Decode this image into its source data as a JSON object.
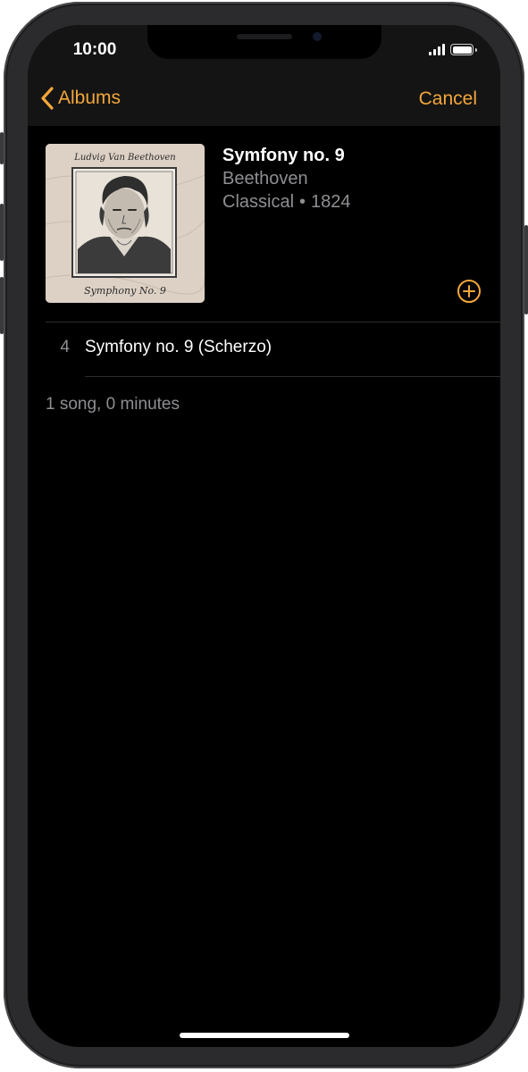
{
  "status_bar": {
    "time": "10:00",
    "signal_icon": "cellular-signal-icon",
    "battery_icon": "battery-icon"
  },
  "nav": {
    "back_label": "Albums",
    "back_icon": "chevron-left-icon",
    "cancel_label": "Cancel"
  },
  "album": {
    "title": "Symfony no. 9",
    "artist": "Beethoven",
    "genre": "Classical",
    "separator": "•",
    "year": "1824",
    "cover_caption_top": "Ludvig Van Beethoven",
    "cover_caption_bottom": "Symphony No. 9",
    "add_icon": "plus-circle-icon"
  },
  "tracks": [
    {
      "number": "4",
      "title": "Symfony no. 9 (Scherzo)"
    }
  ],
  "footer": {
    "summary": "1 song, 0 minutes"
  },
  "colors": {
    "accent": "#f3a73b",
    "background": "#000000",
    "nav_background": "#141414",
    "secondary_text": "#8e8e93"
  }
}
